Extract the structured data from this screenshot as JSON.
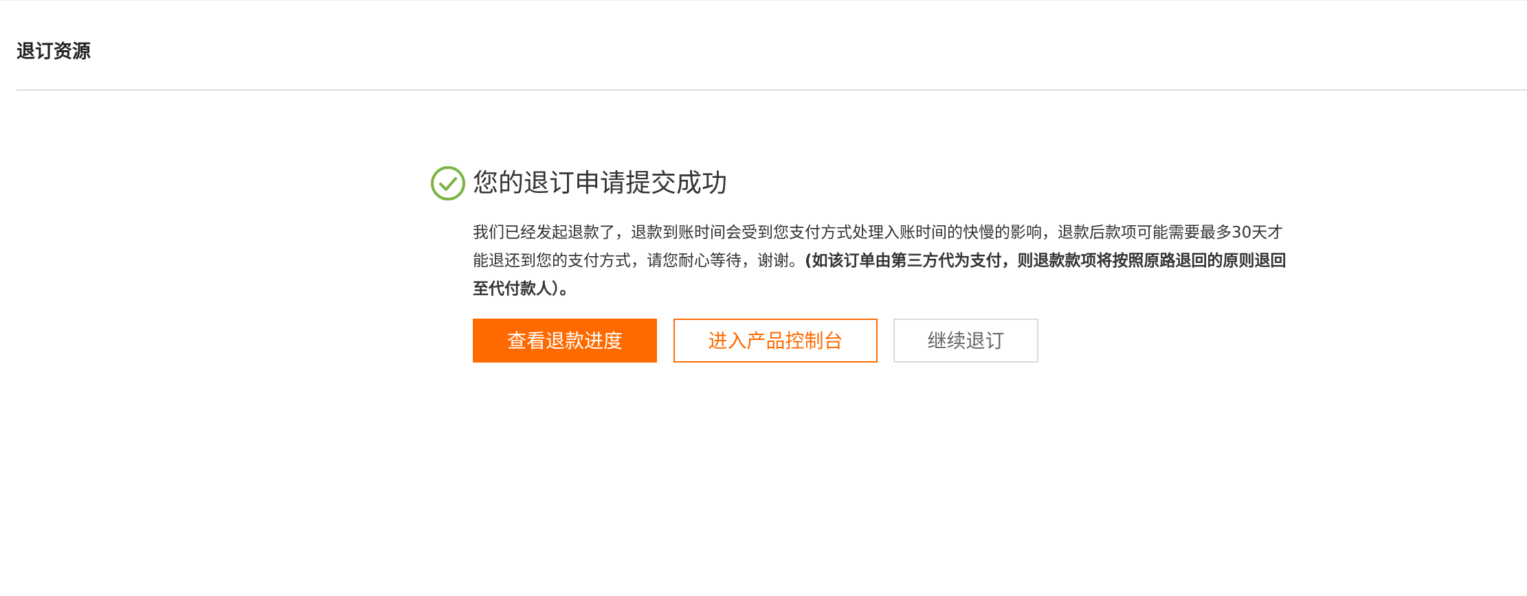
{
  "header": {
    "title": "退订资源"
  },
  "result": {
    "icon": "check-circle-icon",
    "icon_color": "#7cb342",
    "title": "您的退订申请提交成功",
    "description": "我们已经发起退款了，退款到账时间会受到您支付方式处理入账时间的快慢的影响，退款后款项可能需要最多30天才能退还到您的支付方式，请您耐心等待，谢谢。",
    "description_bold": "(如该订单由第三方代为支付，则退款款项将按照原路退回的原则退回至代付款人）。"
  },
  "actions": {
    "view_refund_progress": "查看退款进度",
    "enter_product_console": "进入产品控制台",
    "continue_unsubscribe": "继续退订"
  },
  "colors": {
    "accent": "#ff6a00",
    "success": "#7cb342",
    "text": "#333333",
    "divider": "#dddddd"
  }
}
